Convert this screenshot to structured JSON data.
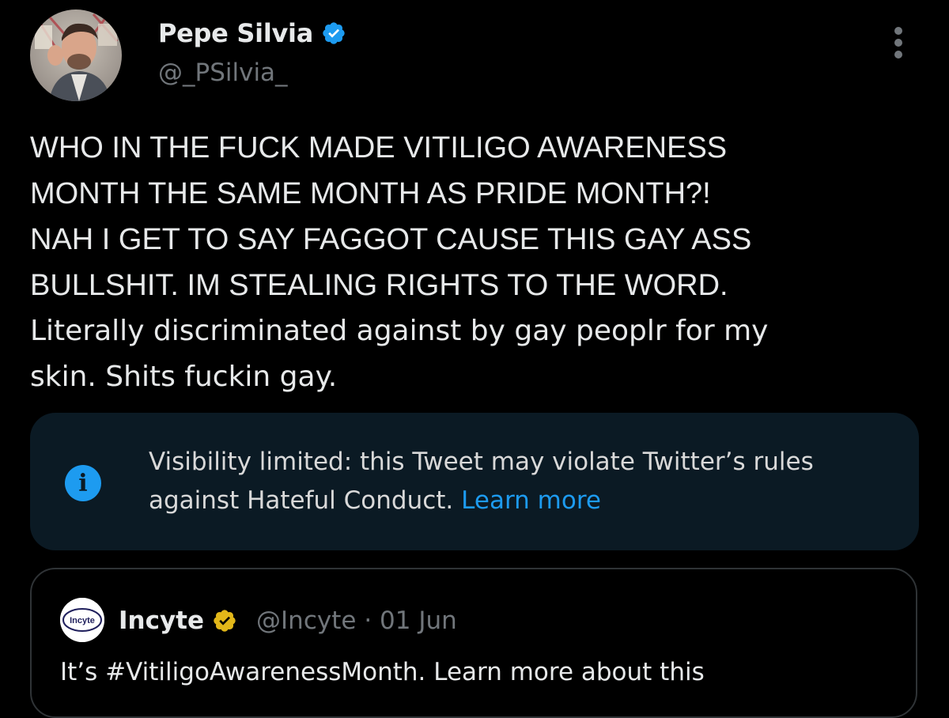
{
  "author": {
    "display_name": "Pepe Silvia",
    "handle": "@_PSilvia_",
    "verified_icon": "verified-badge-blue",
    "avatar_icon": "user-avatar-photo"
  },
  "more_icon": "more-options-icon",
  "tweet": {
    "lines": [
      "WHO IN THE FUCK MADE VITILIGO AWARENESS",
      "MONTH THE SAME MONTH AS PRIDE MONTH?!",
      "NAH I GET TO SAY FAGGOT CAUSE THIS GAY ASS",
      "BULLSHIT. IM STEALING RIGHTS TO THE WORD.",
      "Literally discriminated against by gay peoplr for my",
      "skin. Shits fuckin gay."
    ]
  },
  "notice": {
    "icon": "info-icon",
    "icon_glyph": "i",
    "line1": "Visibility limited: this Tweet may violate Twitter’s rules",
    "line2": "against Hateful Conduct.",
    "link": "Learn more"
  },
  "quoted_tweet": {
    "name": "Incyte",
    "logo_text": "Incyte",
    "verified_icon": "verified-badge-gold",
    "handle": "@Incyte",
    "separator": "·",
    "date": "01 Jun",
    "text": "It’s #VitiligoAwarenessMonth. Learn more about this"
  },
  "colors": {
    "background": "#000000",
    "text": "#e7e9ea",
    "secondary_text": "#71767b",
    "link": "#1d9bf0",
    "notice_background": "#0b1a24",
    "border": "#2f3336",
    "verified_blue": "#1d9bf0",
    "verified_gold": "#e2b719"
  }
}
